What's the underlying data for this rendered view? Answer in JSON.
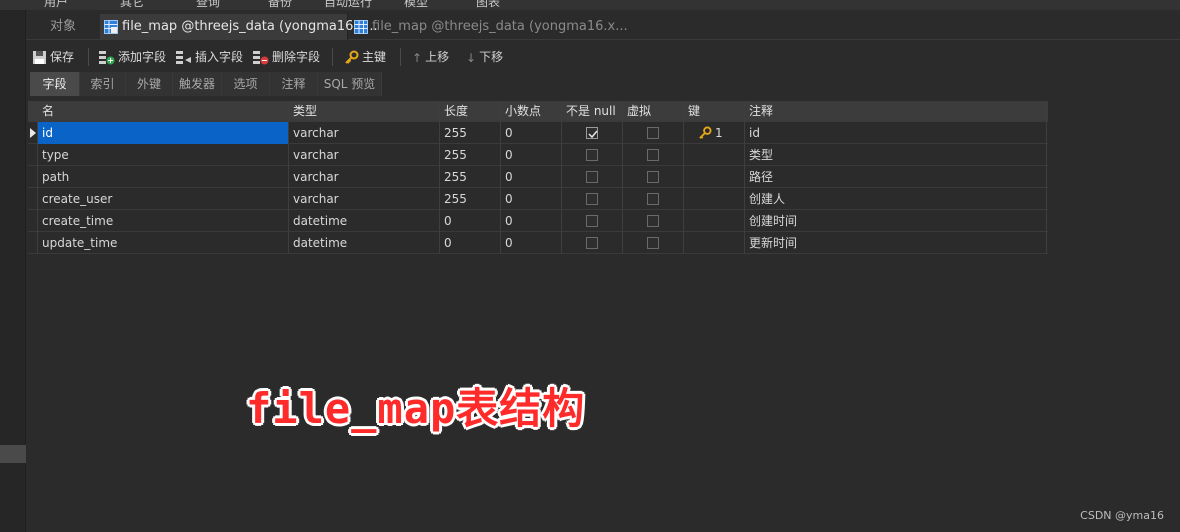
{
  "menu": [
    "用户",
    "其它",
    "查询",
    "备份",
    "自动运行",
    "模型",
    "图表"
  ],
  "tabs": {
    "objects": "对象",
    "active": "file_map @threejs_data (yongma16.x...",
    "inactive": "file_map @threejs_data (yongma16.x..."
  },
  "toolbar": {
    "save": "保存",
    "add_field": "添加字段",
    "insert_field": "插入字段",
    "delete_field": "删除字段",
    "primary_key": "主键",
    "move_up": "上移",
    "move_down": "下移"
  },
  "subtabs": [
    "字段",
    "索引",
    "外键",
    "触发器",
    "选项",
    "注释",
    "SQL 预览"
  ],
  "grid": {
    "headers": [
      "名",
      "类型",
      "长度",
      "小数点",
      "不是 null",
      "虚拟",
      "键",
      "注释"
    ],
    "rows": [
      {
        "name": "id",
        "type": "varchar",
        "length": "255",
        "decimal": "0",
        "not_null": true,
        "virtual": false,
        "key": "1",
        "comment": "id"
      },
      {
        "name": "type",
        "type": "varchar",
        "length": "255",
        "decimal": "0",
        "not_null": false,
        "virtual": false,
        "key": "",
        "comment": "类型"
      },
      {
        "name": "path",
        "type": "varchar",
        "length": "255",
        "decimal": "0",
        "not_null": false,
        "virtual": false,
        "key": "",
        "comment": "路径"
      },
      {
        "name": "create_user",
        "type": "varchar",
        "length": "255",
        "decimal": "0",
        "not_null": false,
        "virtual": false,
        "key": "",
        "comment": "创建人"
      },
      {
        "name": "create_time",
        "type": "datetime",
        "length": "0",
        "decimal": "0",
        "not_null": false,
        "virtual": false,
        "key": "",
        "comment": "创建时间"
      },
      {
        "name": "update_time",
        "type": "datetime",
        "length": "0",
        "decimal": "0",
        "not_null": false,
        "virtual": false,
        "key": "",
        "comment": "更新时间"
      }
    ]
  },
  "overlay_text": "file_map表结构",
  "watermark": "CSDN @yma16",
  "colors": {
    "selection": "#0a64c8",
    "overlay": "#ff2a2a",
    "key_icon": "#e6a817"
  }
}
